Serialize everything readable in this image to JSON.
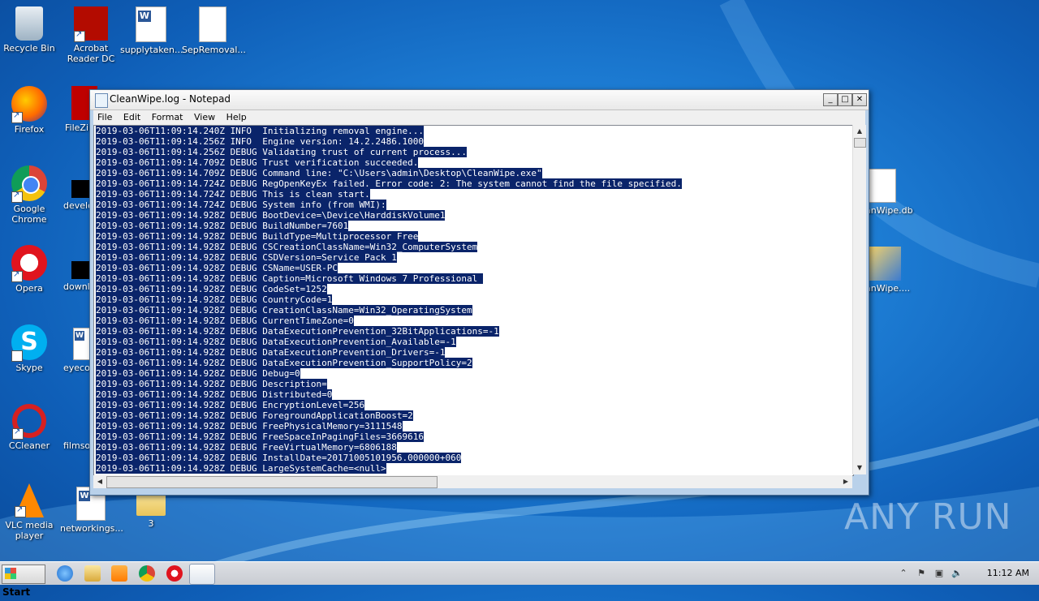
{
  "desktop": {
    "icons": [
      {
        "label": "Recycle Bin"
      },
      {
        "label": "Acrobat\nReader DC"
      },
      {
        "label": "supplytaken..."
      },
      {
        "label": "SepRemoval..."
      },
      {
        "label": "Firefox"
      },
      {
        "label": "FileZilla"
      },
      {
        "label": "Google\nChrome"
      },
      {
        "label": "develo"
      },
      {
        "label": "Opera"
      },
      {
        "label": "downlo"
      },
      {
        "label": "Skype"
      },
      {
        "label": "eyecon"
      },
      {
        "label": "CCleaner"
      },
      {
        "label": "filmsou"
      },
      {
        "label": "VLC media\nplayer"
      },
      {
        "label": "networkings..."
      },
      {
        "label": "3"
      },
      {
        "label": "anWipe.db"
      },
      {
        "label": "anWipe...."
      }
    ],
    "watermark": "ANY RUN"
  },
  "notepad": {
    "title": "CleanWipe.log - Notepad",
    "menu": [
      "File",
      "Edit",
      "Format",
      "View",
      "Help"
    ],
    "lines": [
      "2019-03-06T11:09:14.240Z INFO  Initializing removal engine...",
      "2019-03-06T11:09:14.256Z INFO  Engine version: 14.2.2486.1000",
      "2019-03-06T11:09:14.256Z DEBUG Validating trust of current process...",
      "2019-03-06T11:09:14.709Z DEBUG Trust verification succeeded.",
      "2019-03-06T11:09:14.709Z DEBUG Command line: \"C:\\Users\\admin\\Desktop\\CleanWipe.exe\"",
      "2019-03-06T11:09:14.724Z DEBUG RegOpenKeyEx failed. Error code: 2: The system cannot find the file specified.",
      "2019-03-06T11:09:14.724Z DEBUG This is clean start.",
      "2019-03-06T11:09:14.724Z DEBUG System info (from WMI):",
      "2019-03-06T11:09:14.928Z DEBUG BootDevice=\\Device\\HarddiskVolume1",
      "2019-03-06T11:09:14.928Z DEBUG BuildNumber=7601",
      "2019-03-06T11:09:14.928Z DEBUG BuildType=Multiprocessor Free",
      "2019-03-06T11:09:14.928Z DEBUG CSCreationClassName=Win32_ComputerSystem",
      "2019-03-06T11:09:14.928Z DEBUG CSDVersion=Service Pack 1",
      "2019-03-06T11:09:14.928Z DEBUG CSName=USER-PC",
      "2019-03-06T11:09:14.928Z DEBUG Caption=Microsoft Windows 7 Professional ",
      "2019-03-06T11:09:14.928Z DEBUG CodeSet=1252",
      "2019-03-06T11:09:14.928Z DEBUG CountryCode=1",
      "2019-03-06T11:09:14.928Z DEBUG CreationClassName=Win32_OperatingSystem",
      "2019-03-06T11:09:14.928Z DEBUG CurrentTimeZone=0",
      "2019-03-06T11:09:14.928Z DEBUG DataExecutionPrevention_32BitApplications=-1",
      "2019-03-06T11:09:14.928Z DEBUG DataExecutionPrevention_Available=-1",
      "2019-03-06T11:09:14.928Z DEBUG DataExecutionPrevention_Drivers=-1",
      "2019-03-06T11:09:14.928Z DEBUG DataExecutionPrevention_SupportPolicy=2",
      "2019-03-06T11:09:14.928Z DEBUG Debug=0",
      "2019-03-06T11:09:14.928Z DEBUG Description=",
      "2019-03-06T11:09:14.928Z DEBUG Distributed=0",
      "2019-03-06T11:09:14.928Z DEBUG EncryptionLevel=256",
      "2019-03-06T11:09:14.928Z DEBUG ForegroundApplicationBoost=2",
      "2019-03-06T11:09:14.928Z DEBUG FreePhysicalMemory=3111548",
      "2019-03-06T11:09:14.928Z DEBUG FreeSpaceInPagingFiles=3669616",
      "2019-03-06T11:09:14.928Z DEBUG FreeVirtualMemory=6806188",
      "2019-03-06T11:09:14.928Z DEBUG InstallDate=20171005101956.000000+060",
      "2019-03-06T11:09:14.928Z DEBUG LargeSystemCache=<null>"
    ]
  },
  "taskbar": {
    "start_label": "Start",
    "clock": "11:12 AM"
  }
}
